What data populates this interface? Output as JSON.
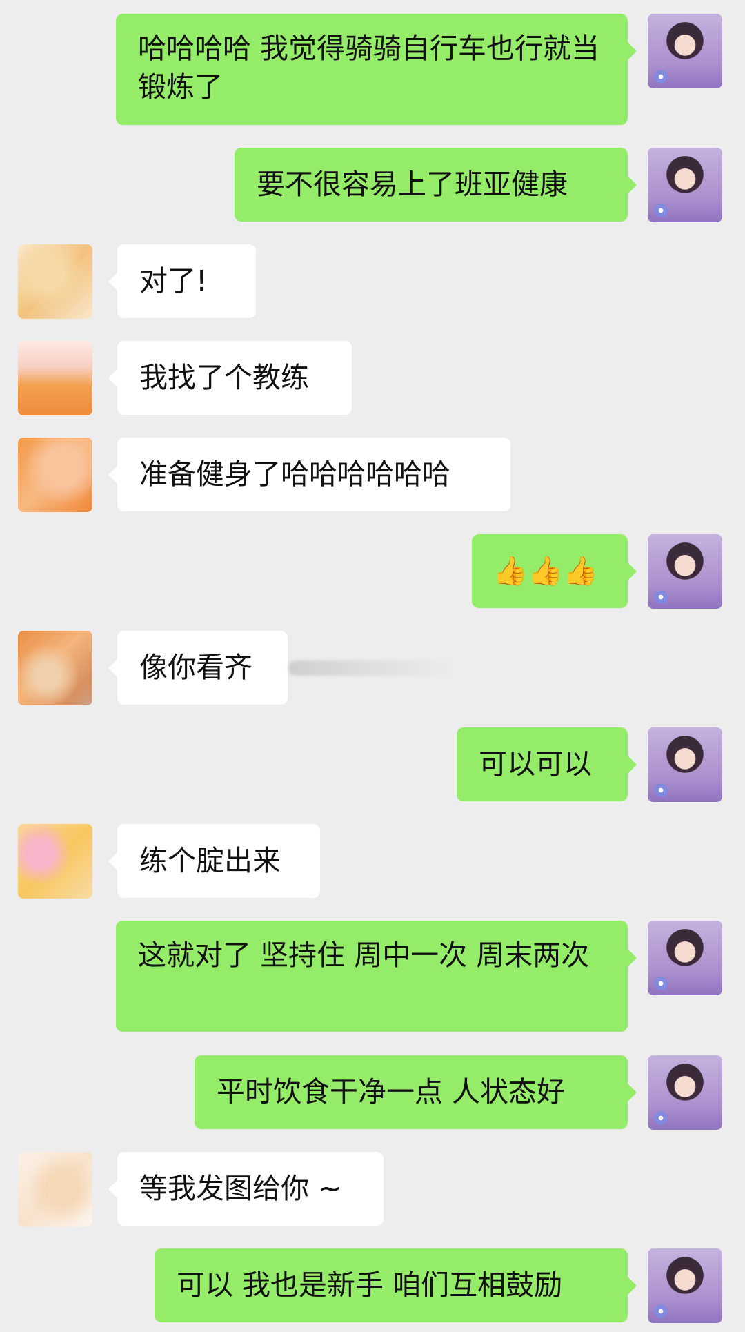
{
  "messages": [
    {
      "sender": "self",
      "text": "哈哈哈哈 我觉得骑骑自行车也行就当锻炼了"
    },
    {
      "sender": "self",
      "text": "要不很容易上了班亚健康"
    },
    {
      "sender": "other",
      "text": "对了!"
    },
    {
      "sender": "other",
      "text": "我找了个教练"
    },
    {
      "sender": "other",
      "text": "准备健身了哈哈哈哈哈哈"
    },
    {
      "sender": "self",
      "text": "👍👍👍"
    },
    {
      "sender": "other",
      "text": "像你看齐"
    },
    {
      "sender": "self",
      "text": "可以可以"
    },
    {
      "sender": "other",
      "text": "练个腚出来"
    },
    {
      "sender": "self",
      "text": "这就对了 坚持住 周中一次 周末两次"
    },
    {
      "sender": "self",
      "text": "平时饮食干净一点 人状态好"
    },
    {
      "sender": "other",
      "text": "等我发图给你 ~"
    },
    {
      "sender": "self",
      "text": "可以 我也是新手 咱们互相鼓励"
    }
  ]
}
